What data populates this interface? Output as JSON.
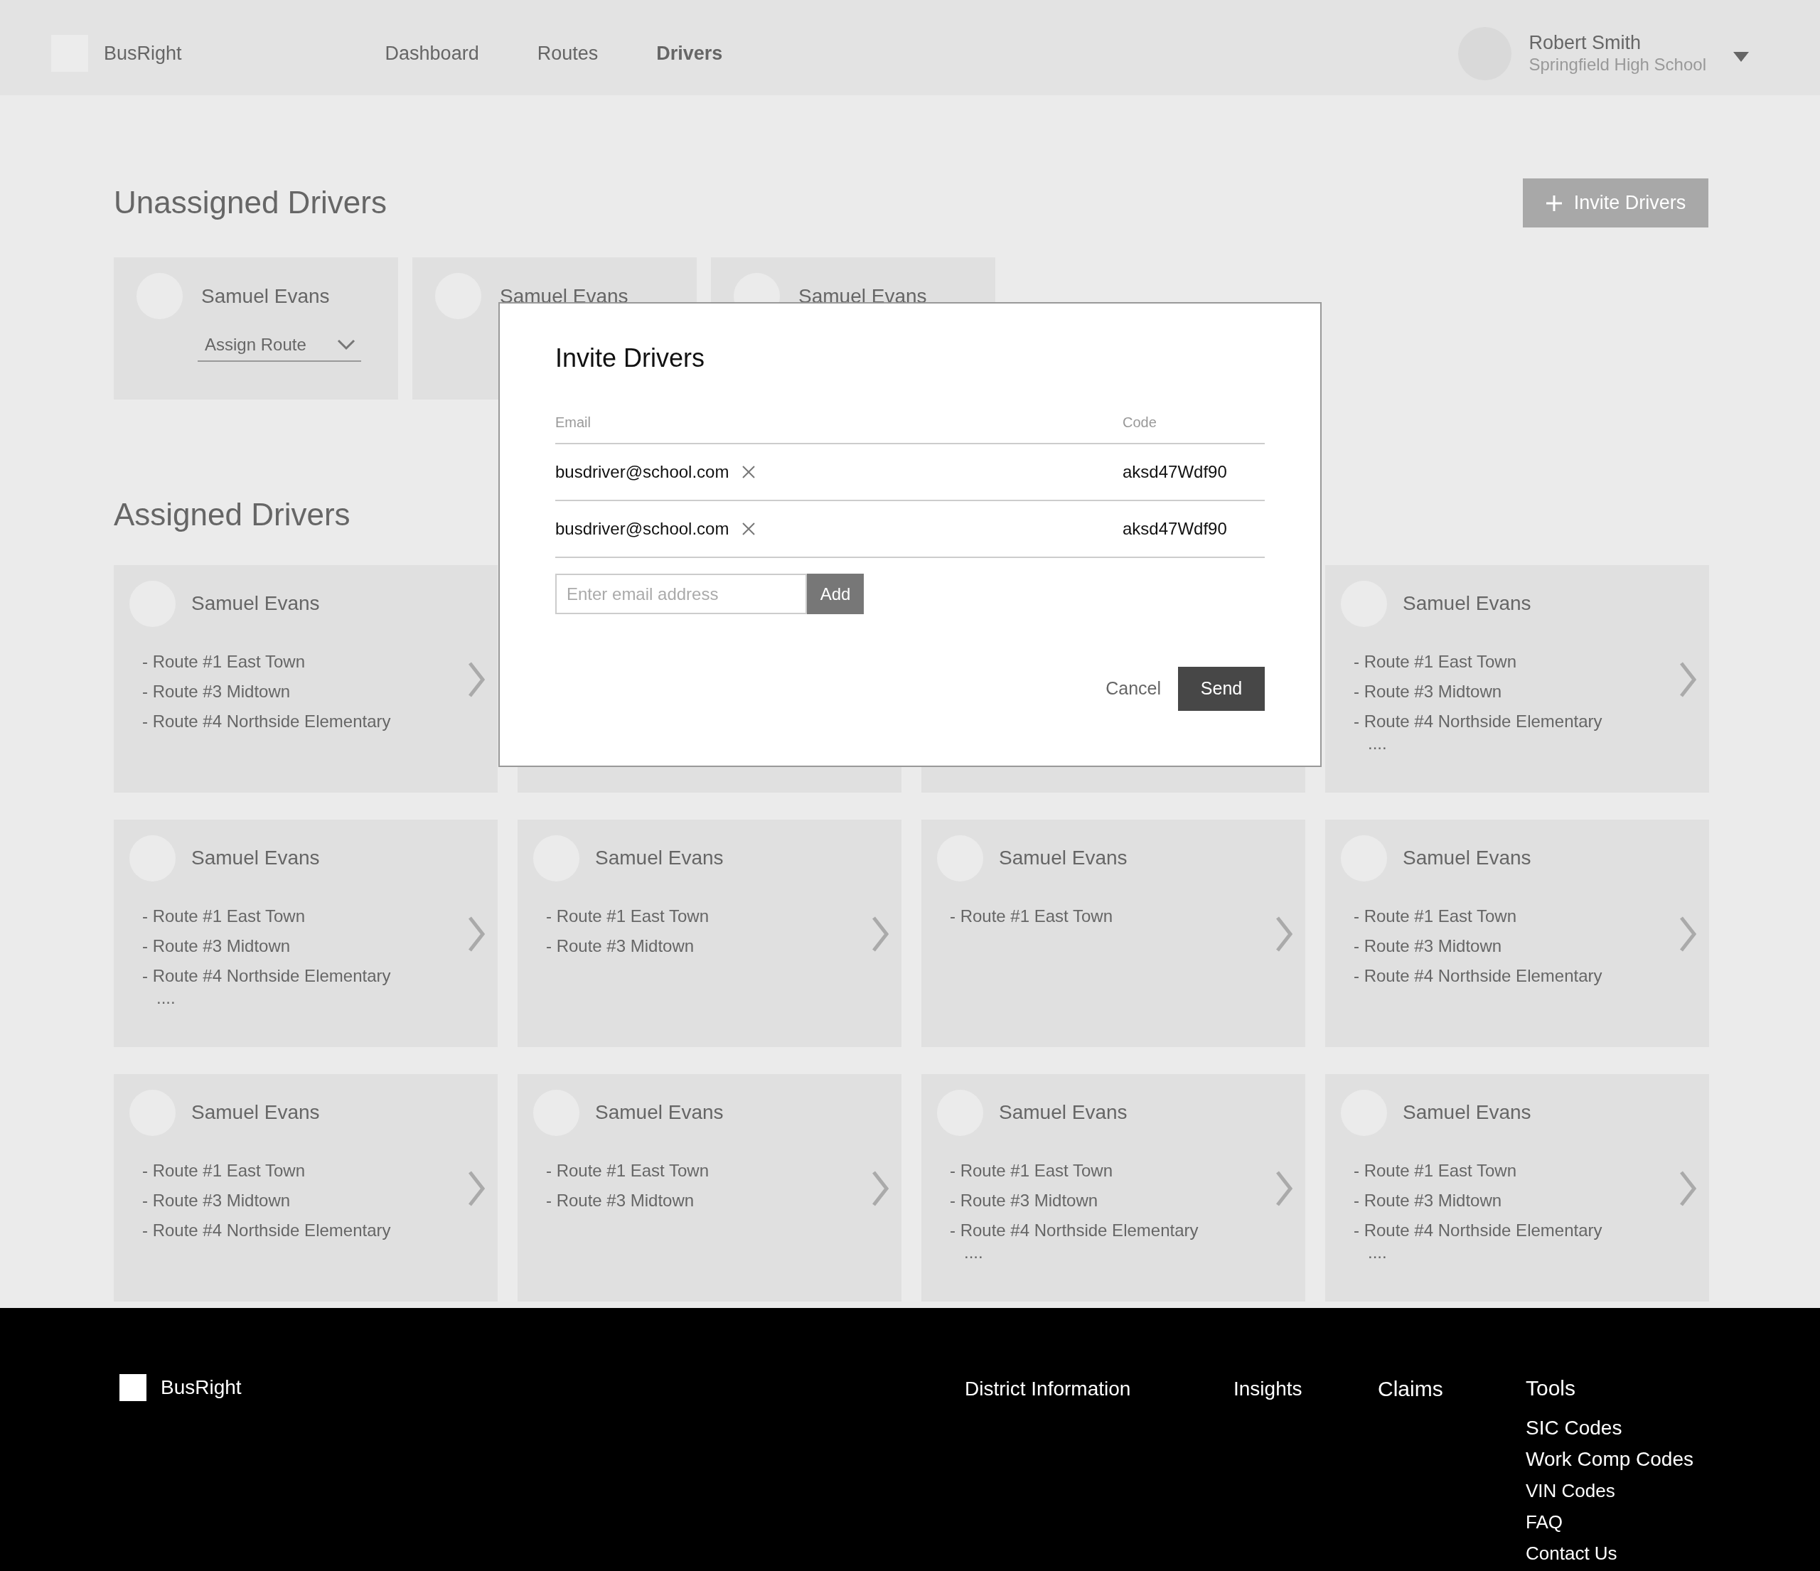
{
  "header": {
    "logo": "BusRight",
    "nav": [
      {
        "label": "Dashboard",
        "selected": false
      },
      {
        "label": "Routes",
        "selected": false
      },
      {
        "label": "Drivers",
        "selected": true
      }
    ],
    "user": {
      "name": "Robert Smith",
      "school": "Springfield High School"
    }
  },
  "unassigned": {
    "title": "Unassigned Drivers",
    "invite_button": "Invite Drivers",
    "drivers": [
      {
        "name": "Samuel Evans",
        "assign": "Assign Route"
      },
      {
        "name": "Samuel Evans"
      },
      {
        "name": "Samuel Evans"
      }
    ]
  },
  "assigned": {
    "title": "Assigned Drivers",
    "drivers": [
      {
        "kind": "card",
        "name": "Samuel Evans",
        "routes": [
          "- Route #1 East Town",
          "- Route #3 Midtown",
          "- Route #4 Northside Elementary"
        ]
      },
      {
        "kind": "covered"
      },
      {
        "kind": "covered"
      },
      {
        "kind": "card",
        "name": "Samuel Evans",
        "routes": [
          "- Route #1 East Town",
          "- Route #3 Midtown",
          "- Route #4 Northside Elementary"
        ],
        "more": "...."
      },
      {
        "kind": "card",
        "name": "Samuel Evans",
        "routes": [
          "- Route #1 East Town",
          "- Route #3 Midtown",
          "- Route #4 Northside Elementary"
        ],
        "more": "...."
      },
      {
        "kind": "card",
        "name": "Samuel Evans",
        "routes": [
          "- Route #1 East Town",
          "- Route #3 Midtown"
        ]
      },
      {
        "kind": "card",
        "name": "Samuel Evans",
        "routes": [
          "- Route #1 East Town"
        ]
      },
      {
        "kind": "card",
        "name": "Samuel Evans",
        "routes": [
          "- Route #1 East Town",
          "- Route #3 Midtown",
          "- Route #4 Northside Elementary"
        ]
      },
      {
        "kind": "card",
        "name": "Samuel Evans",
        "routes": [
          "- Route #1 East Town",
          "- Route #3 Midtown",
          "- Route #4 Northside Elementary"
        ]
      },
      {
        "kind": "card",
        "name": "Samuel Evans",
        "routes": [
          "- Route #1 East Town",
          "- Route #3 Midtown"
        ]
      },
      {
        "kind": "card",
        "name": "Samuel Evans",
        "routes": [
          "- Route #1 East Town",
          "- Route #3 Midtown",
          "- Route #4 Northside Elementary"
        ],
        "more": "...."
      },
      {
        "kind": "card",
        "name": "Samuel Evans",
        "routes": [
          "- Route #1 East Town",
          "- Route #3 Midtown",
          "- Route #4 Northside Elementary"
        ],
        "more": "...."
      }
    ]
  },
  "modal": {
    "title": "Invite Drivers",
    "columns": [
      "Email",
      "Code"
    ],
    "rows": [
      {
        "email": "busdriver@school.com",
        "code": "aksd47Wdf90"
      },
      {
        "email": "busdriver@school.com",
        "code": "aksd47Wdf90"
      }
    ],
    "input": {
      "placeholder": "Enter email address"
    },
    "add_button": "Add",
    "cancel": "Cancel",
    "send": "Send"
  },
  "footer": {
    "logo": "BusRight",
    "links": [
      "District Information",
      "Insights",
      "Claims"
    ],
    "tools": {
      "title": "Tools",
      "items": [
        "SIC Codes",
        "Work Comp Codes",
        "VIN Codes",
        "FAQ",
        "Contact Us"
      ]
    }
  }
}
